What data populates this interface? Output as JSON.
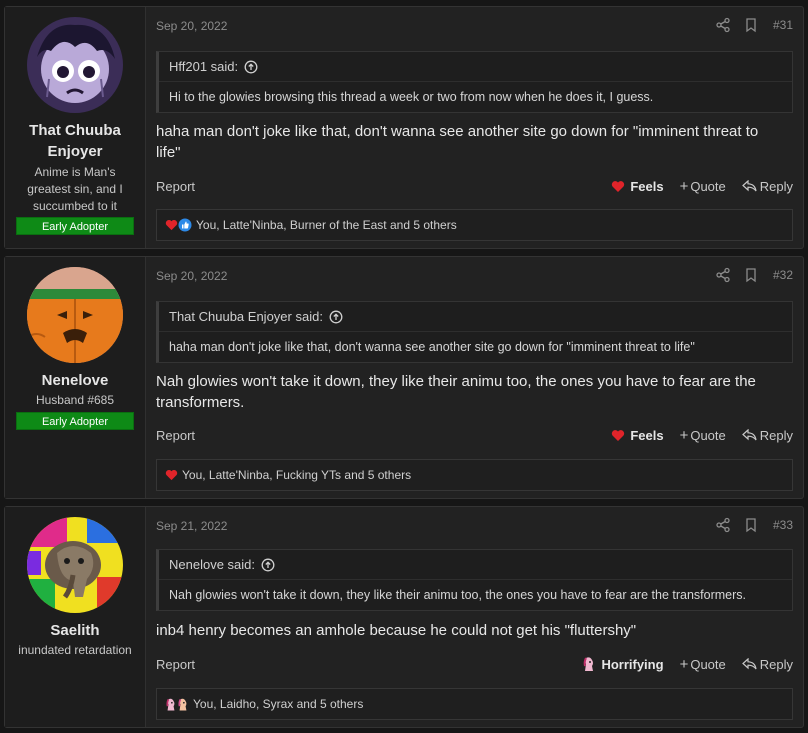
{
  "posts": [
    {
      "user": {
        "name": "That Chuuba Enjoyer",
        "title": "Anime is Man's greatest sin, and I succumbed to it",
        "banner": "Early Adopter"
      },
      "date": "Sep 20, 2022",
      "number": "#31",
      "quote": {
        "author": "Hff201 said:",
        "text": "Hi to the glowies browsing this thread a week or two from now when he does it, I guess."
      },
      "message": "haha man don't joke like that, don't wanna see another site go down for \"imminent threat to life\"",
      "report": "Report",
      "reaction_label": "Feels",
      "quote_label": "Quote",
      "reply_label": "Reply",
      "reactions_text": "You, Latte'Ninba, Burner of the East and 5 others",
      "reaction_icons": [
        "heart-icon",
        "like-icon"
      ]
    },
    {
      "user": {
        "name": "Nenelove",
        "title": "Husband #685",
        "banner": "Early Adopter"
      },
      "date": "Sep 20, 2022",
      "number": "#32",
      "quote": {
        "author": "That Chuuba Enjoyer said:",
        "text": "haha man don't joke like that, don't wanna see another site go down for \"imminent threat to life\""
      },
      "message": "Nah glowies won't take it down, they like their animu too, the ones you have to fear are the transformers.",
      "report": "Report",
      "reaction_label": "Feels",
      "quote_label": "Quote",
      "reply_label": "Reply",
      "reactions_text": "You, Latte'Ninba, Fucking YTs and 5 others",
      "reaction_icons": [
        "heart-icon"
      ]
    },
    {
      "user": {
        "name": "Saelith",
        "title": "inundated retardation"
      },
      "date": "Sep 21, 2022",
      "number": "#33",
      "quote": {
        "author": "Nenelove said:",
        "text": "Nah glowies won't take it down, they like their animu too, the ones you have to fear are the transformers."
      },
      "message": "inb4 henry becomes an amhole because he could not get his \"fluttershy\"",
      "report": "Report",
      "reaction_label": "Horrifying",
      "quote_label": "Quote",
      "reply_label": "Reply",
      "reactions_text": "You, Laidho, Syrax and 5 others",
      "reaction_icons": [
        "pony-icon",
        "pony-icon"
      ]
    }
  ],
  "colors": {
    "background": "#161616",
    "post": "#222222",
    "banner": "#0e8a16",
    "heart": "#e0242a",
    "like": "#2d8ae8"
  }
}
